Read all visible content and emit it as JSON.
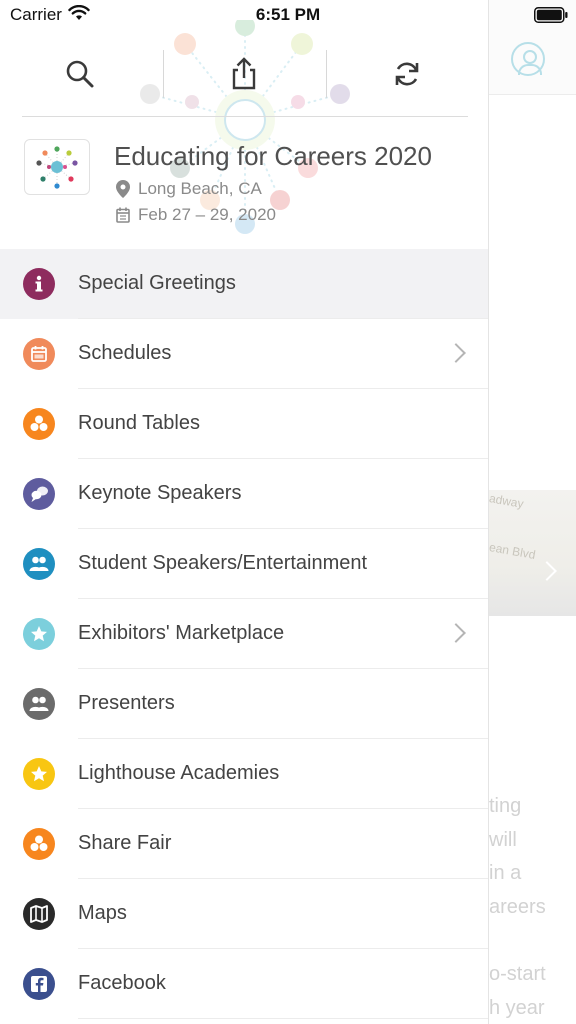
{
  "status_bar": {
    "carrier": "Carrier",
    "time": "6:51 PM"
  },
  "toolbar": {
    "search_icon": "search-icon",
    "share_icon": "share-icon",
    "refresh_icon": "refresh-icon"
  },
  "event": {
    "title": "Educating for Careers 2020",
    "location": "Long Beach, CA",
    "dates": "Feb 27 – 29, 2020"
  },
  "menu": {
    "items": [
      {
        "label": "Special Greetings",
        "icon": "info-icon",
        "color": "#8e2c5e",
        "active": true,
        "chevron": false
      },
      {
        "label": "Schedules",
        "icon": "calendar-icon",
        "color": "#f08a5b",
        "active": false,
        "chevron": true
      },
      {
        "label": "Round Tables",
        "icon": "three-circles-icon",
        "color": "#f7861e",
        "active": false,
        "chevron": false
      },
      {
        "label": "Keynote Speakers",
        "icon": "speech-bubbles-icon",
        "color": "#5e5c9e",
        "active": false,
        "chevron": false
      },
      {
        "label": "Student Speakers/Entertainment",
        "icon": "people-icon",
        "color": "#1f8fc0",
        "active": false,
        "chevron": false
      },
      {
        "label": "Exhibitors' Marketplace",
        "icon": "star-icon",
        "color": "#7ccfdc",
        "active": false,
        "chevron": true
      },
      {
        "label": "Presenters",
        "icon": "people-icon",
        "color": "#6b6b6b",
        "active": false,
        "chevron": false
      },
      {
        "label": "Lighthouse Academies",
        "icon": "star-icon",
        "color": "#f8c612",
        "active": false,
        "chevron": false
      },
      {
        "label": "Share Fair",
        "icon": "three-circles-icon",
        "color": "#f7861e",
        "active": false,
        "chevron": false
      },
      {
        "label": "Maps",
        "icon": "map-icon",
        "color": "#2a2a2a",
        "active": false,
        "chevron": false
      },
      {
        "label": "Facebook",
        "icon": "facebook-icon",
        "color": "#3b4f8e",
        "active": false,
        "chevron": false
      }
    ]
  },
  "background": {
    "street_1": "adway",
    "street_2": "ean Blvd",
    "text_lines": [
      "ting",
      "will",
      "in a",
      "areers",
      "",
      "o-start",
      "h year"
    ]
  },
  "colors": {
    "accent": "#7ccfdc",
    "separator": "#ececec"
  }
}
